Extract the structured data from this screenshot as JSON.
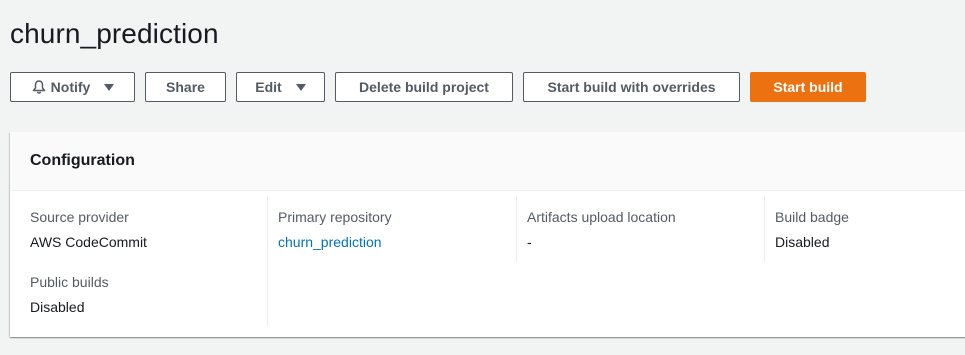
{
  "header": {
    "title": "churn_prediction"
  },
  "actions": {
    "notify_label": "Notify",
    "share_label": "Share",
    "edit_label": "Edit",
    "delete_label": "Delete build project",
    "start_overrides_label": "Start build with overrides",
    "start_build_label": "Start build"
  },
  "configuration": {
    "title": "Configuration",
    "fields": {
      "source_provider": {
        "label": "Source provider",
        "value": "AWS CodeCommit"
      },
      "primary_repository": {
        "label": "Primary repository",
        "value": "churn_prediction"
      },
      "artifacts_upload_location": {
        "label": "Artifacts upload location",
        "value": "-"
      },
      "build_badge": {
        "label": "Build badge",
        "value": "Disabled"
      },
      "public_builds": {
        "label": "Public builds",
        "value": "Disabled"
      }
    }
  },
  "colors": {
    "primary": "#ec7211",
    "link": "#0073bb",
    "background": "#f2f3f3"
  },
  "icons": {
    "notify": "bell-icon",
    "dropdown": "caret-down-icon"
  }
}
